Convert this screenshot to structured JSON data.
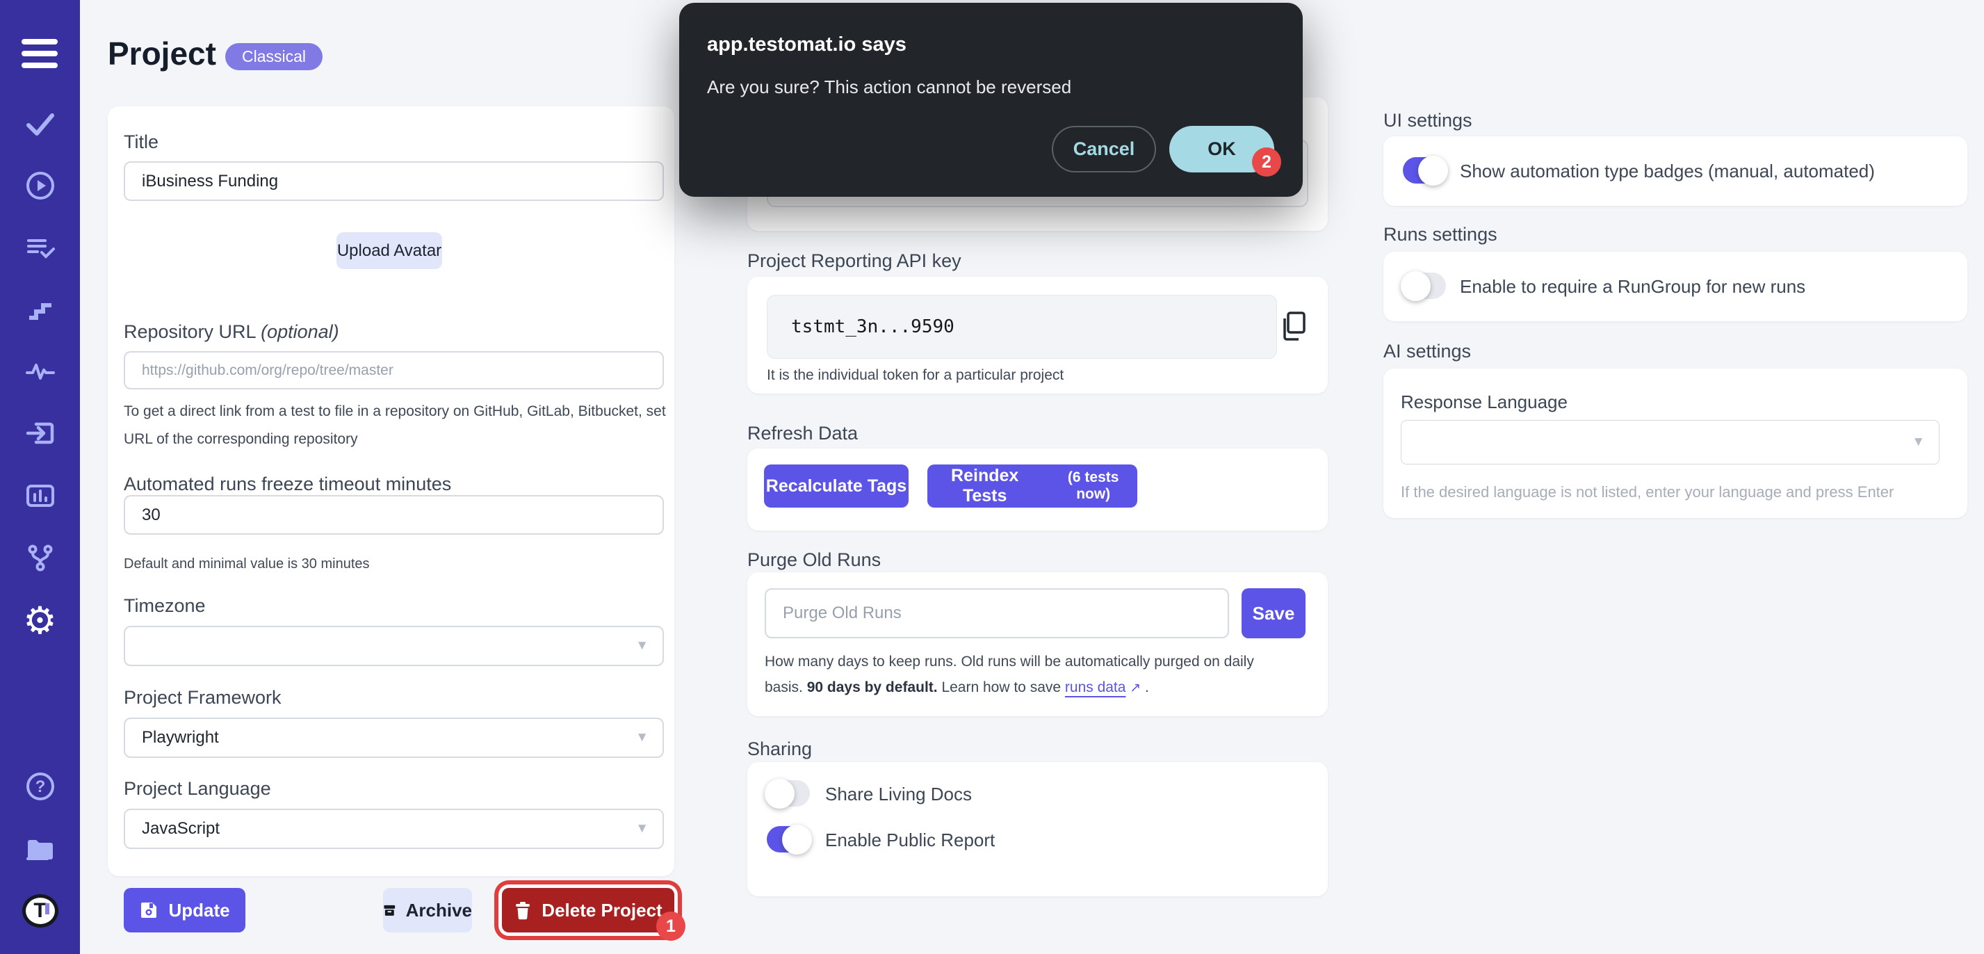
{
  "header": {
    "title": "Project",
    "badge": "Classical"
  },
  "dialog": {
    "title": "app.testomat.io says",
    "message": "Are you sure? This action cannot be reversed",
    "cancel": "Cancel",
    "ok": "OK",
    "step_badge": "2"
  },
  "icons": {
    "caret": "▼",
    "question": "?",
    "gear": "⚙",
    "logo_letter": "T",
    "external": "↗"
  },
  "sidebar": {
    "items": [
      "menu",
      "tests",
      "runs",
      "plans",
      "steps",
      "analytics",
      "import",
      "reports",
      "branches",
      "settings",
      "help",
      "projects",
      "logo"
    ]
  },
  "form": {
    "title": {
      "label": "Title",
      "value": "iBusiness Funding"
    },
    "avatar_button": "Upload Avatar",
    "repo": {
      "label": "Repository URL",
      "optional": "(optional)",
      "placeholder": "https://github.com/org/repo/tree/master",
      "help": "To get a direct link from a test to file in a repository on GitHub, GitLab, Bitbucket, set URL of the corresponding repository"
    },
    "freeze": {
      "label": "Automated runs freeze timeout minutes",
      "value": "30",
      "help": "Default and minimal value is 30 minutes"
    },
    "timezone": {
      "label": "Timezone",
      "value": ""
    },
    "framework": {
      "label": "Project Framework",
      "value": "Playwright"
    },
    "language": {
      "label": "Project Language",
      "value": "JavaScript"
    },
    "actions": {
      "update": "Update",
      "archive": "Archive",
      "delete": "Delete Project",
      "delete_step_badge": "1"
    }
  },
  "reporting": {
    "label": "Project Reporting API key",
    "token": "tstmt_3n...9590",
    "help": "It is the individual token for a particular project"
  },
  "refresh": {
    "label": "Refresh Data",
    "recalculate": "Recalculate Tags",
    "reindex": "Reindex Tests",
    "reindex_note": "(6 tests now)"
  },
  "purge": {
    "label": "Purge Old Runs",
    "placeholder": "Purge Old Runs",
    "save": "Save",
    "help_1": "How many days to keep runs. Old runs will be automatically purged on daily basis. ",
    "help_bold": "90 days by default.",
    "help_2": " Learn how to save ",
    "link": "runs data",
    "help_3": " ."
  },
  "sharing": {
    "label": "Sharing",
    "toggles": [
      {
        "label": "Share Living Docs",
        "on": false
      },
      {
        "label": "Enable Public Report",
        "on": true
      }
    ]
  },
  "ui_settings": {
    "label": "UI settings",
    "toggle_label": "Show automation type badges (manual, automated)",
    "on": true
  },
  "runs_settings": {
    "label": "Runs settings",
    "toggle_label": "Enable to require a RunGroup for new runs",
    "on": false
  },
  "ai_settings": {
    "label": "AI settings",
    "field_label": "Response Language",
    "value": "",
    "help": "If the desired language is not listed, enter your language and press Enter"
  },
  "colors": {
    "sidebar": "#37309e",
    "accent": "#5b54e6",
    "danger_button": "#a82020",
    "annotation_red": "#e84848",
    "ok_button": "#a5dae4",
    "dialog_bg": "#22262b",
    "badge_bg": "#817ae4"
  }
}
